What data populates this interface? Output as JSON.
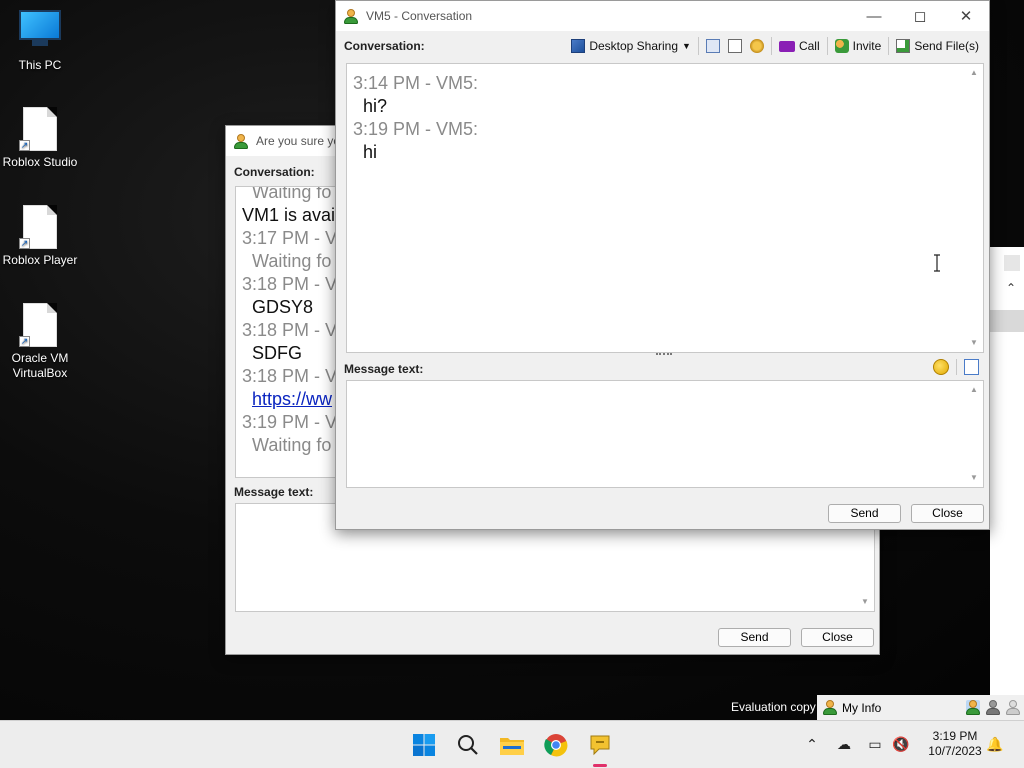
{
  "desktop": {
    "icons": [
      {
        "label": "This PC"
      },
      {
        "label": "Roblox Studio"
      },
      {
        "label": "Roblox Player"
      },
      {
        "label": "Oracle VM VirtualBox"
      }
    ],
    "eval_text": "Evaluation copy"
  },
  "back_window": {
    "title": "Are you sure yo",
    "conversation_label": "Conversation:",
    "lines": [
      {
        "kind": "gray",
        "text": "Waiting fo"
      },
      {
        "kind": "msg",
        "text": "VM1 is avai"
      },
      {
        "kind": "ts",
        "text": "3:17 PM - V"
      },
      {
        "kind": "gray",
        "text": "Waiting fo"
      },
      {
        "kind": "ts",
        "text": "3:18 PM - V"
      },
      {
        "kind": "msg",
        "text": "GDSY8"
      },
      {
        "kind": "ts",
        "text": "3:18 PM - V"
      },
      {
        "kind": "msg",
        "text": "SDFG"
      },
      {
        "kind": "ts",
        "text": "3:18 PM - V"
      },
      {
        "kind": "link",
        "text": "https://ww"
      },
      {
        "kind": "ts",
        "text": "3:19 PM - V"
      },
      {
        "kind": "gray",
        "text": "Waiting fo"
      }
    ],
    "message_label": "Message text:",
    "send_label": "Send",
    "close_label": "Close"
  },
  "front_window": {
    "title": "VM5 - Conversation",
    "conversation_label": "Conversation:",
    "toolbar": {
      "desktop_sharing": "Desktop Sharing",
      "call": "Call",
      "invite": "Invite",
      "send_files": "Send File(s)"
    },
    "messages": [
      {
        "time": "3:14 PM - VM5:",
        "text": "hi?"
      },
      {
        "time": "3:19 PM - VM5:",
        "text": "hi"
      }
    ],
    "message_label": "Message text:",
    "send_label": "Send",
    "close_label": "Close"
  },
  "status_bar": {
    "my_info": "My Info"
  },
  "taskbar": {
    "time": "3:19 PM",
    "date": "10/7/2023",
    "apps": [
      "windows-start",
      "search",
      "file-explorer",
      "chrome",
      "messenger"
    ]
  },
  "colors": {
    "accent": "#0078d4",
    "link": "#0a24c0",
    "timestamp": "#8a8a8a"
  }
}
